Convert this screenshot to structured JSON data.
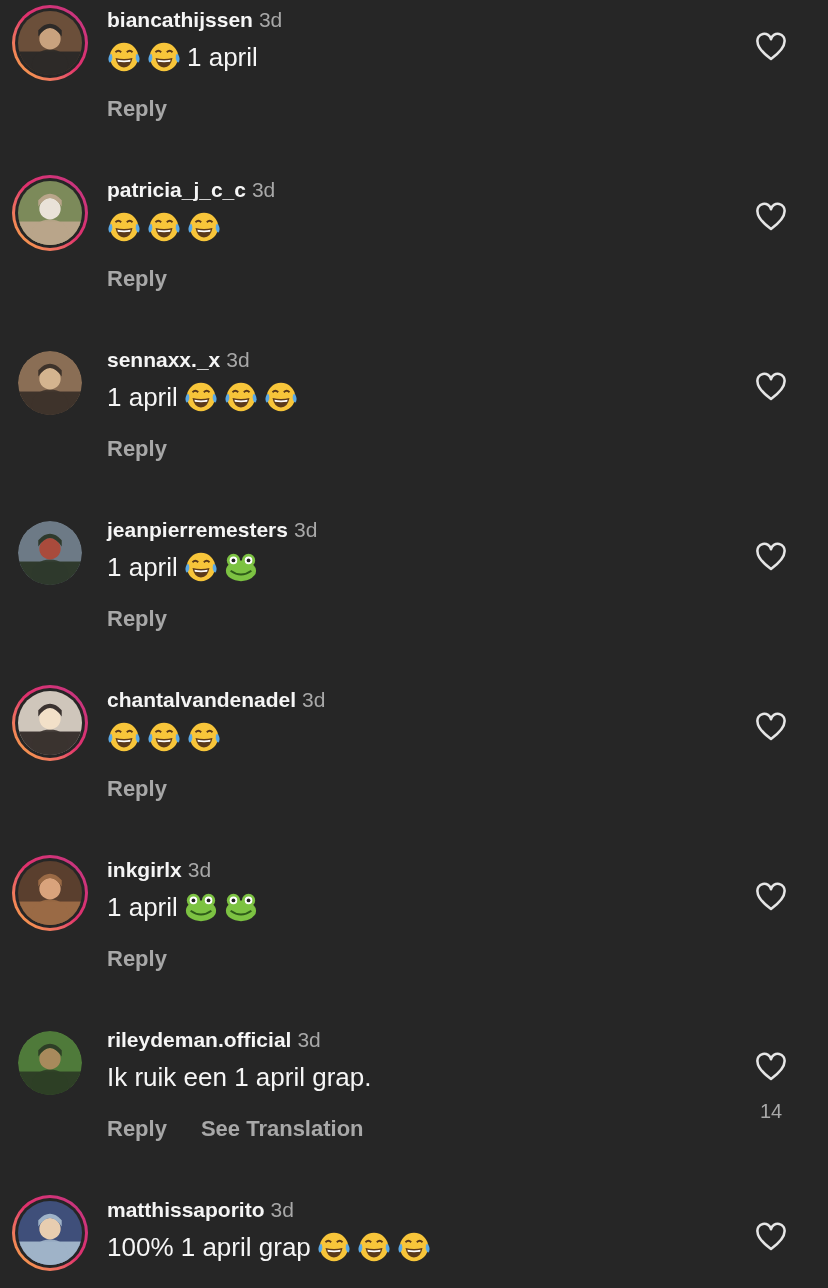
{
  "comments": [
    {
      "username": "biancathijssen",
      "time": "3d",
      "story_ring": true,
      "parts": [
        {
          "kind": "laugh"
        },
        {
          "kind": "laugh"
        },
        {
          "kind": "text",
          "text": "1 april"
        }
      ],
      "reply": "Reply"
    },
    {
      "username": "patricia_j_c_c",
      "time": "3d",
      "story_ring": true,
      "parts": [
        {
          "kind": "laugh"
        },
        {
          "kind": "laugh"
        },
        {
          "kind": "laugh"
        }
      ],
      "reply": "Reply"
    },
    {
      "username": "sennaxx._x",
      "time": "3d",
      "story_ring": false,
      "parts": [
        {
          "kind": "text",
          "text": "1 april"
        },
        {
          "kind": "laugh"
        },
        {
          "kind": "laugh"
        },
        {
          "kind": "laugh"
        }
      ],
      "reply": "Reply"
    },
    {
      "username": "jeanpierremesters",
      "time": "3d",
      "story_ring": false,
      "parts": [
        {
          "kind": "text",
          "text": "1 april"
        },
        {
          "kind": "laugh"
        },
        {
          "kind": "frog"
        }
      ],
      "reply": "Reply"
    },
    {
      "username": "chantalvandenadel",
      "time": "3d",
      "story_ring": true,
      "parts": [
        {
          "kind": "laugh"
        },
        {
          "kind": "laugh"
        },
        {
          "kind": "laugh"
        }
      ],
      "reply": "Reply"
    },
    {
      "username": "inkgirlx",
      "time": "3d",
      "story_ring": true,
      "parts": [
        {
          "kind": "text",
          "text": "1 april"
        },
        {
          "kind": "frog"
        },
        {
          "kind": "frog"
        }
      ],
      "reply": "Reply"
    },
    {
      "username": "rileydeman.official",
      "time": "3d",
      "story_ring": false,
      "parts": [
        {
          "kind": "text",
          "text": "Ik ruik een 1 april grap."
        }
      ],
      "reply": "Reply",
      "translation": "See Translation",
      "likes": "14"
    },
    {
      "username": "matthissaporito",
      "time": "3d",
      "story_ring": true,
      "parts": [
        {
          "kind": "text",
          "text": "100% 1 april grap"
        },
        {
          "kind": "laugh"
        },
        {
          "kind": "laugh"
        },
        {
          "kind": "laugh"
        }
      ]
    }
  ]
}
